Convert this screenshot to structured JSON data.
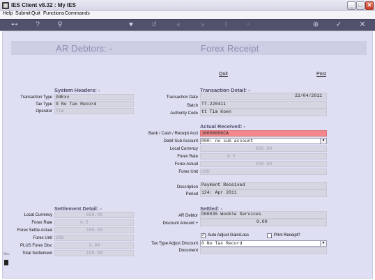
{
  "window": {
    "title": "IES Client v8.32 : My IES",
    "minimize": "_",
    "maximize": "□",
    "close": "✕"
  },
  "menu": {
    "items": [
      "Help",
      "Submit",
      "Quit",
      "Functions",
      "Commands"
    ]
  },
  "toolbar": {
    "icons": [
      "key-icon",
      "help-icon",
      "search-icon",
      "heart-icon",
      "undo-icon",
      "rewind-icon",
      "fast-forward-icon",
      "text-cursor-icon",
      "page-icon",
      "add-icon",
      "check-icon",
      "close-icon"
    ]
  },
  "header": {
    "left_title": "AR Debtors: -",
    "right_title": "Forex Receipt"
  },
  "actions": {
    "quit": "Quit",
    "post": "Post"
  },
  "system_headers": {
    "title": "System Headers: -",
    "transaction_type_label": "Transaction Type",
    "transaction_type_value": "04Exx",
    "tax_type_label": "Tax Type",
    "tax_type_value": "0 No Tax Record",
    "operator_label": "Operator",
    "operator_value": "Tim"
  },
  "transaction_detail": {
    "title": "Transaction Detail: -",
    "date_label": "Transaction Date",
    "date_value": "22/04/2011",
    "batch_label": "Batch",
    "batch_value": "TT-220411",
    "authority_label": "Authority Code",
    "authority_value": "tt Tim Koen"
  },
  "actual_received": {
    "title": "Actual Received: -",
    "bank_label": "Bank / Cash / Receipt Acct",
    "bank_value": "10000006CA",
    "debit_sub_label": "Debit Sub Account",
    "debit_sub_value": "000: no sub account",
    "local_currency_label": "Local Currency",
    "local_currency_value": "650.00",
    "forex_rate_label": "Forex Rate",
    "forex_rate_value": "6.5",
    "forex_actual_label": "Forex Actual",
    "forex_actual_value": "100.00",
    "forex_unit_label": "Forex Unit",
    "forex_unit_value": "USD"
  },
  "description": {
    "description_label": "Description",
    "description_value": "Payment Received",
    "period_label": "Period",
    "period_value": "124: Apr 2011"
  },
  "settlement_detail": {
    "title": "Settlement Detail: -",
    "local_currency_label": "Local Currency",
    "local_currency_value": "650.00",
    "forex_rate_label": "Forex Rate",
    "forex_rate_value": "6.5",
    "forex_settle_label": "Forex Settle Actual",
    "forex_settle_value": "100.00",
    "forex_unit_label": "Forex Unit",
    "forex_unit_value": "USD",
    "plus_forex_disc_label": "PLUS Forex Disc",
    "plus_forex_disc_value": "0.00",
    "total_settlement_label": "Total Settlement",
    "total_settlement_value": "100.00"
  },
  "settled": {
    "title": "Settled: -",
    "ar_debtor_label": "AR Debtor",
    "ar_debtor_value": "D00035 Wooble Services",
    "discount_label": "Discount Amount +",
    "discount_value": "0.00",
    "auto_adjust_label": "Auto Adjust Gain/Loss",
    "auto_adjust_checked": true,
    "print_receipt_label": "Print Receipt?",
    "print_receipt_checked": false,
    "tax_type_discount_label": "Tax Type Adjust Discount",
    "tax_type_discount_value": "0 No Tax Record",
    "document_label": "Document",
    "document_value": ""
  },
  "side": {
    "label": "Sec"
  }
}
